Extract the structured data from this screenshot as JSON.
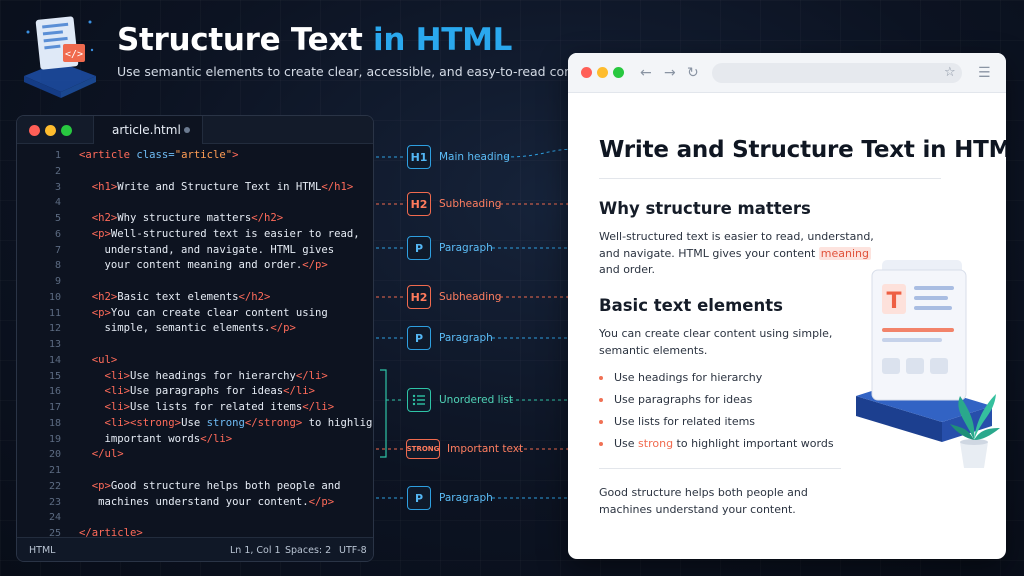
{
  "header": {
    "title_main": "Structure Text",
    "title_accent": "in HTML",
    "subtitle": "Use semantic elements to create clear, accessible, and easy-to-read content."
  },
  "editor": {
    "tab_label": "article.html",
    "lines": [
      {
        "n": "1",
        "parts": [
          [
            "t",
            "<article "
          ],
          [
            "a",
            "class="
          ],
          [
            "s",
            "\"article\""
          ],
          [
            "t",
            ">"
          ]
        ]
      },
      {
        "n": "2",
        "parts": []
      },
      {
        "n": "3",
        "parts": [
          [
            "",
            "  "
          ],
          [
            "t",
            "<h1>"
          ],
          [
            "",
            "Write and Structure Text in HTML"
          ],
          [
            "t",
            "</h1>"
          ]
        ]
      },
      {
        "n": "4",
        "parts": []
      },
      {
        "n": "5",
        "parts": [
          [
            "",
            "  "
          ],
          [
            "t",
            "<h2>"
          ],
          [
            "",
            "Why structure matters"
          ],
          [
            "t",
            "</h2>"
          ]
        ]
      },
      {
        "n": "6",
        "parts": [
          [
            "",
            "  "
          ],
          [
            "t",
            "<p>"
          ],
          [
            "",
            "Well-structured text is easier to read,"
          ]
        ]
      },
      {
        "n": "7",
        "parts": [
          [
            "",
            "    understand, and navigate. HTML gives"
          ]
        ]
      },
      {
        "n": "8",
        "parts": [
          [
            "",
            "    your content meaning and order."
          ],
          [
            "t",
            "</p>"
          ]
        ]
      },
      {
        "n": "9",
        "parts": []
      },
      {
        "n": "10",
        "parts": [
          [
            "",
            "  "
          ],
          [
            "t",
            "<h2>"
          ],
          [
            "",
            "Basic text elements"
          ],
          [
            "t",
            "</h2>"
          ]
        ]
      },
      {
        "n": "11",
        "parts": [
          [
            "",
            "  "
          ],
          [
            "t",
            "<p>"
          ],
          [
            "",
            "You can create clear content using"
          ]
        ]
      },
      {
        "n": "12",
        "parts": [
          [
            "",
            "    simple, semantic elements."
          ],
          [
            "t",
            "</p>"
          ]
        ]
      },
      {
        "n": "13",
        "parts": []
      },
      {
        "n": "14",
        "parts": [
          [
            "",
            "  "
          ],
          [
            "t",
            "<ul>"
          ]
        ]
      },
      {
        "n": "15",
        "parts": [
          [
            "",
            "    "
          ],
          [
            "t",
            "<li>"
          ],
          [
            "",
            "Use headings for hierarchy"
          ],
          [
            "t",
            "</li>"
          ]
        ]
      },
      {
        "n": "16",
        "parts": [
          [
            "",
            "    "
          ],
          [
            "t",
            "<li>"
          ],
          [
            "",
            "Use paragraphs for ideas"
          ],
          [
            "t",
            "</li>"
          ]
        ]
      },
      {
        "n": "17",
        "parts": [
          [
            "",
            "    "
          ],
          [
            "t",
            "<li>"
          ],
          [
            "",
            "Use lists for related items"
          ],
          [
            "t",
            "</li>"
          ]
        ]
      },
      {
        "n": "18",
        "parts": [
          [
            "",
            "    "
          ],
          [
            "t",
            "<li><strong>"
          ],
          [
            "",
            "Use "
          ],
          [
            "kw",
            "strong"
          ],
          [
            "t",
            "</strong>"
          ],
          [
            "",
            " to highlight"
          ]
        ]
      },
      {
        "n": "19",
        "parts": [
          [
            "",
            "    important words"
          ],
          [
            "t",
            "</li>"
          ]
        ]
      },
      {
        "n": "20",
        "parts": [
          [
            "",
            "  "
          ],
          [
            "t",
            "</ul>"
          ]
        ]
      },
      {
        "n": "21",
        "parts": []
      },
      {
        "n": "22",
        "parts": [
          [
            "",
            "  "
          ],
          [
            "t",
            "<p>"
          ],
          [
            "",
            "Good structure helps both people and"
          ]
        ]
      },
      {
        "n": "23",
        "parts": [
          [
            "",
            "   machines understand your content."
          ],
          [
            "t",
            "</p>"
          ]
        ]
      },
      {
        "n": "24",
        "parts": []
      },
      {
        "n": "25",
        "parts": [
          [
            "t",
            "</article>"
          ]
        ]
      }
    ],
    "status": {
      "language": "HTML",
      "position": "Ln 1, Col 1",
      "spaces": "Spaces: 2",
      "encoding": "UTF-8"
    }
  },
  "connectors": [
    {
      "badge": "H1",
      "label": "Main heading",
      "color": "blue"
    },
    {
      "badge": "H2",
      "label": "Subheading",
      "color": "orange"
    },
    {
      "badge": "P",
      "label": "Paragraph",
      "color": "blue"
    },
    {
      "badge": "H2",
      "label": "Subheading",
      "color": "orange"
    },
    {
      "badge": "P",
      "label": "Paragraph",
      "color": "blue"
    },
    {
      "badge": "list-icon",
      "label": "Unordered list",
      "color": "teal"
    },
    {
      "badge": "STRONG",
      "label": "Important text",
      "color": "orange"
    },
    {
      "badge": "P",
      "label": "Paragraph",
      "color": "blue"
    }
  ],
  "preview": {
    "h1": "Write and Structure Text in HTML",
    "h2_first": "Why structure matters",
    "p1_line1": "Well-structured text is easier to read, understand,",
    "p1_line2_pre": "and navigate. HTML gives your content ",
    "p1_highlight": "meaning",
    "p1_line3": "and order.",
    "h2_second": "Basic text elements",
    "p2_line1": "You can create clear content using simple,",
    "p2_line2": "semantic elements.",
    "list": [
      "Use headings for hierarchy",
      "Use paragraphs for ideas",
      "Use lists for related items"
    ],
    "list_last_pre": "Use ",
    "list_last_strong": "strong",
    "list_last_post": " to highlight important words",
    "p3_line1": "Good structure helps both people and",
    "p3_line2": "machines understand your content."
  },
  "illustration": {
    "doc_letter": "T"
  },
  "colors": {
    "accent_blue": "#2aa8ee",
    "accent_orange": "#f06a4e",
    "teal": "#2ec4a6",
    "background": "#0c1322"
  }
}
